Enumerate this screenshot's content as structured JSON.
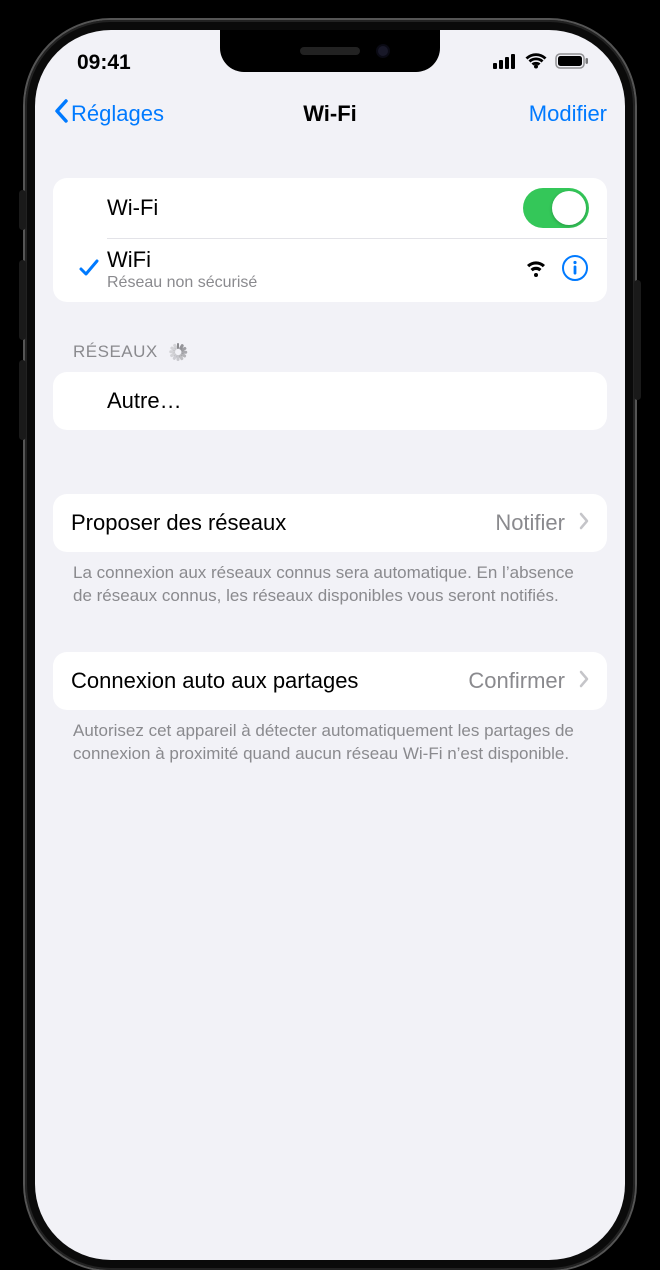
{
  "status": {
    "time": "09:41"
  },
  "nav": {
    "back_label": "Réglages",
    "title": "Wi-Fi",
    "edit_label": "Modifier"
  },
  "wifi_toggle": {
    "label": "Wi-Fi",
    "on": true
  },
  "connected": {
    "name": "WiFi",
    "security": "Réseau non sécurisé"
  },
  "networks_header": "RÉSEAUX",
  "other_row": "Autre…",
  "ask_join": {
    "label": "Proposer des réseaux",
    "value": "Notifier",
    "footer": "La connexion aux réseaux connus sera automatique. En l’absence de réseaux connus, les réseaux disponibles vous seront notifiés."
  },
  "auto_hotspot": {
    "label": "Connexion auto aux partages",
    "value": "Confirmer",
    "footer": "Autorisez cet appareil à détecter automatiquement les partages de connexion à proximité quand aucun réseau Wi-Fi n’est disponible."
  }
}
